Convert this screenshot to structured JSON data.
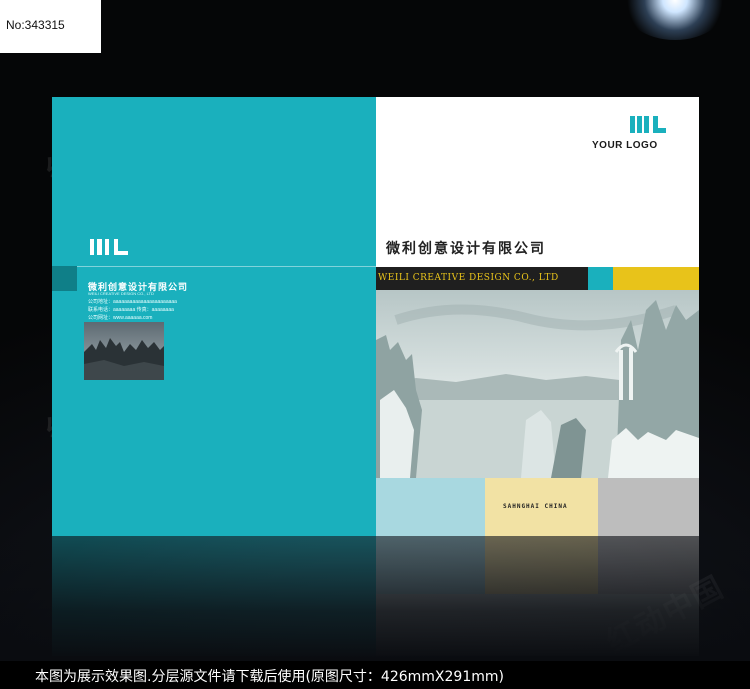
{
  "id_tag": "No:343315",
  "left_page": {
    "company_cn": "微利创意设计有限公司",
    "company_en": "WEILI CREATIVE DESIGN CO., LTD",
    "info_lines": [
      "公司地址：aaaaaaaaaaaaaaaaaaaaaaa",
      "联系电话：aaaaaaaa 传真：aaaaaaaa",
      "公司网址：www.aaaaaa.com"
    ]
  },
  "right_page": {
    "logo_text": "YOUR LOGO",
    "company_cn": "微利创意设计有限公司",
    "company_en": "WEILI CREATIVE DESIGN CO., LTD",
    "location": "SAHNGHAI CHINA"
  },
  "colors": {
    "teal": "#1ab0bd",
    "yellow": "#e8c31a",
    "light_blue": "#a8d8e0",
    "cream": "#f2e2a4",
    "gray": "#bdbdbd"
  },
  "caption": "本图为展示效果图.分层源文件请下载后使用(原图尺寸：426mmX291mm)"
}
